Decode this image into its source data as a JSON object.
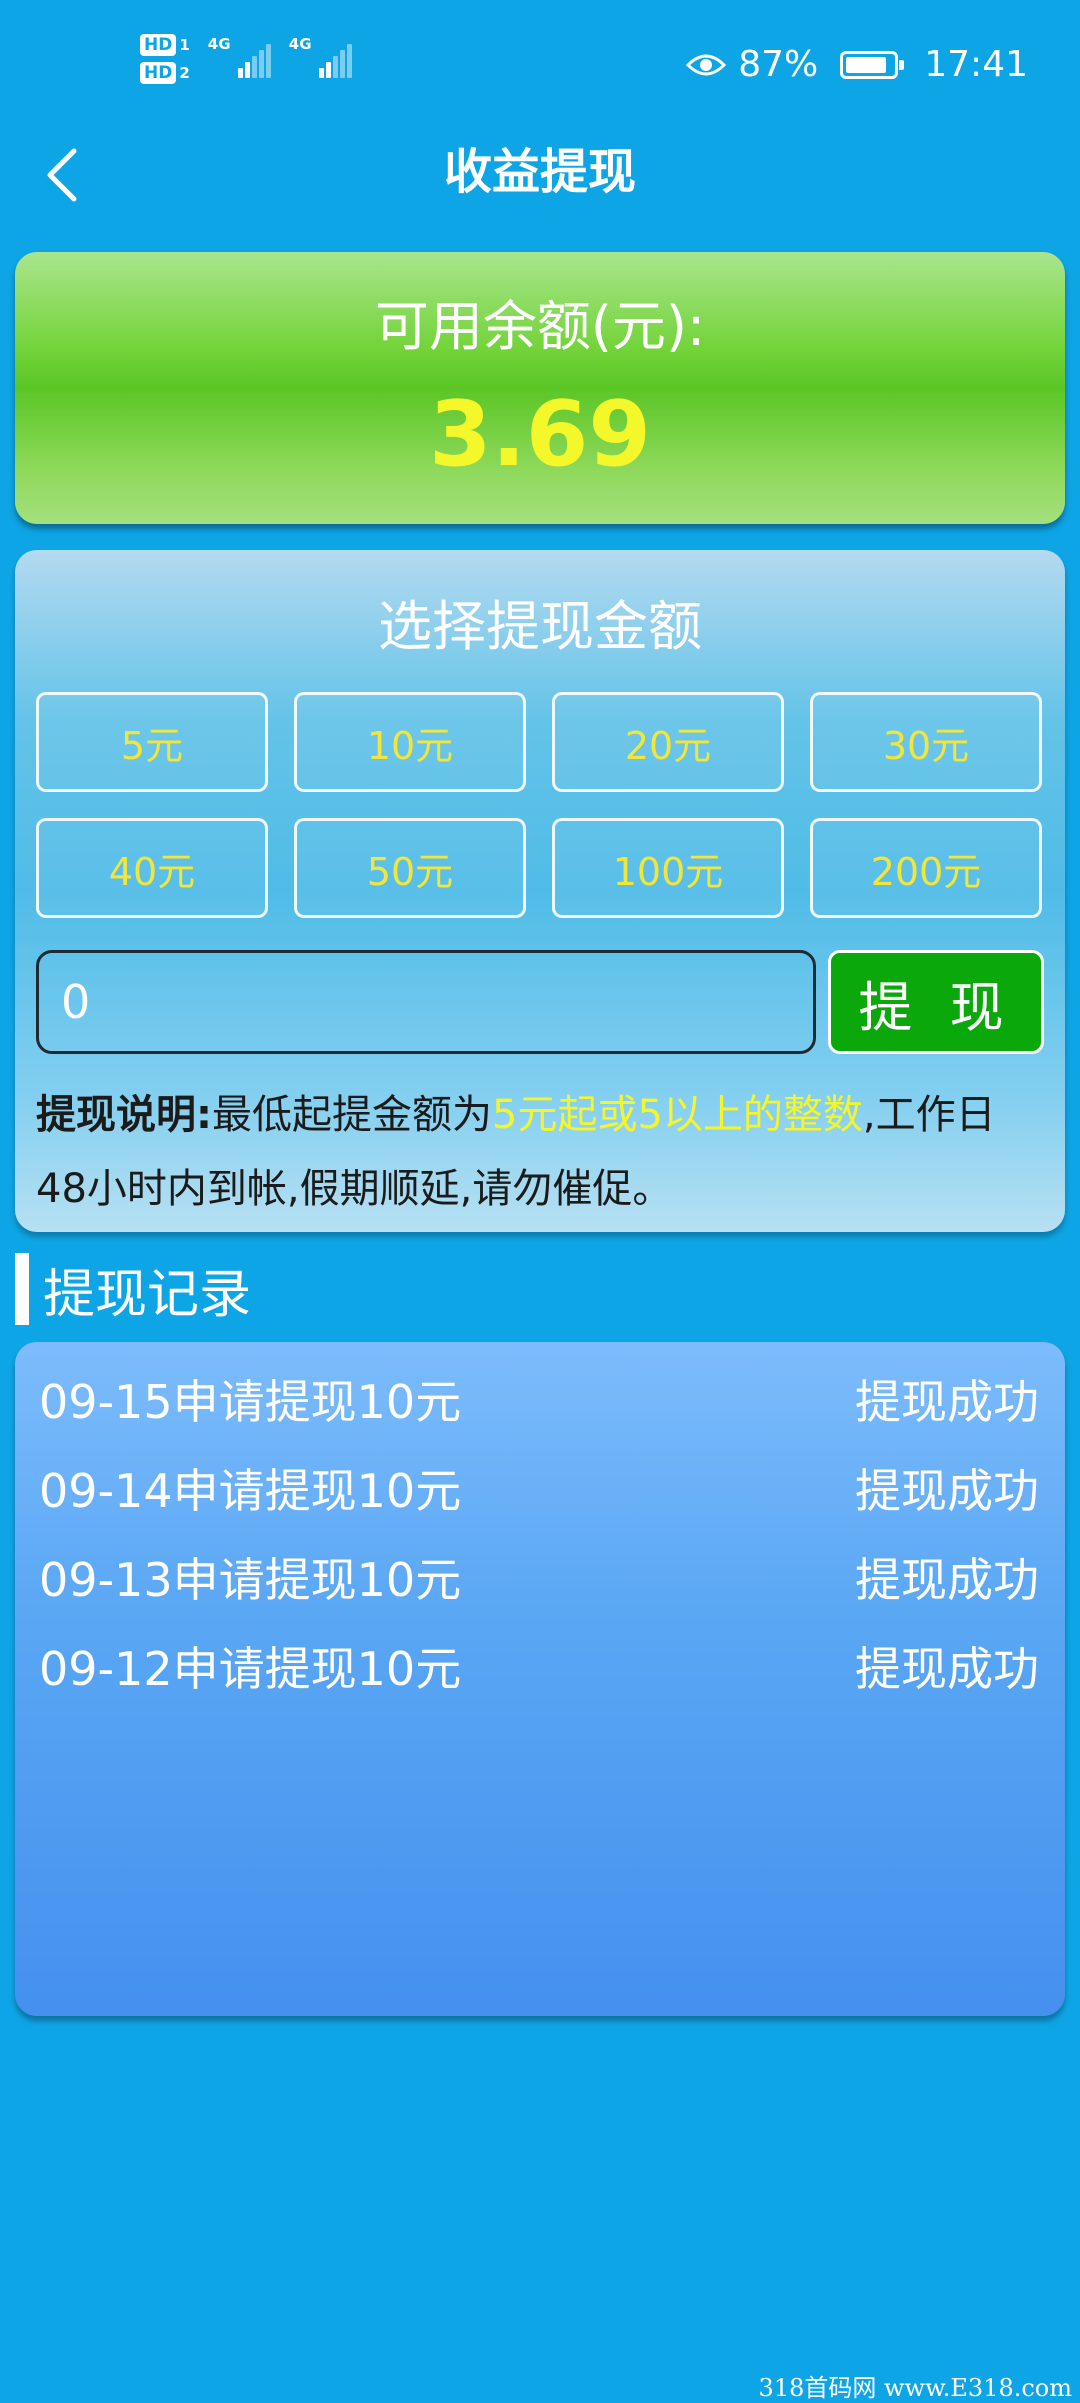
{
  "status_bar": {
    "sim_badge": "HD",
    "sim1": "1",
    "sim2": "2",
    "network1": "4G",
    "network2": "4G",
    "battery_percent": "87%",
    "battery_level": 0.87,
    "time": "17:41",
    "icons": [
      "eye-icon",
      "signal-icon",
      "battery-icon"
    ]
  },
  "header": {
    "title": "收益提现",
    "back_icon": "chevron-left-icon"
  },
  "balance": {
    "label": "可用余额(元):",
    "value": "3.69"
  },
  "amount_panel": {
    "title": "选择提现金额",
    "options": [
      "5元",
      "10元",
      "20元",
      "30元",
      "40元",
      "50元",
      "100元",
      "200元"
    ],
    "input_value": "0",
    "withdraw_label": "提 现",
    "note_label": "提现说明:",
    "note_prefix": "最低起提金额为",
    "note_highlight": "5元起或5以上的整数",
    "note_suffix": ",工作日48小时内到帐,假期顺延,请勿催促。"
  },
  "records": {
    "title": "提现记录",
    "items": [
      {
        "text": "09-15申请提现10元",
        "status": "提现成功"
      },
      {
        "text": "09-14申请提现10元",
        "status": "提现成功"
      },
      {
        "text": "09-13申请提现10元",
        "status": "提现成功"
      },
      {
        "text": "09-12申请提现10元",
        "status": "提现成功"
      }
    ]
  },
  "watermark": "318首码网 www.E318.com",
  "colors": {
    "background": "#0ea5e6",
    "balance_value": "#f4f72a",
    "option_text": "#f2e63a",
    "withdraw_button": "#0aa80a",
    "note_highlight": "#f4f52a"
  }
}
